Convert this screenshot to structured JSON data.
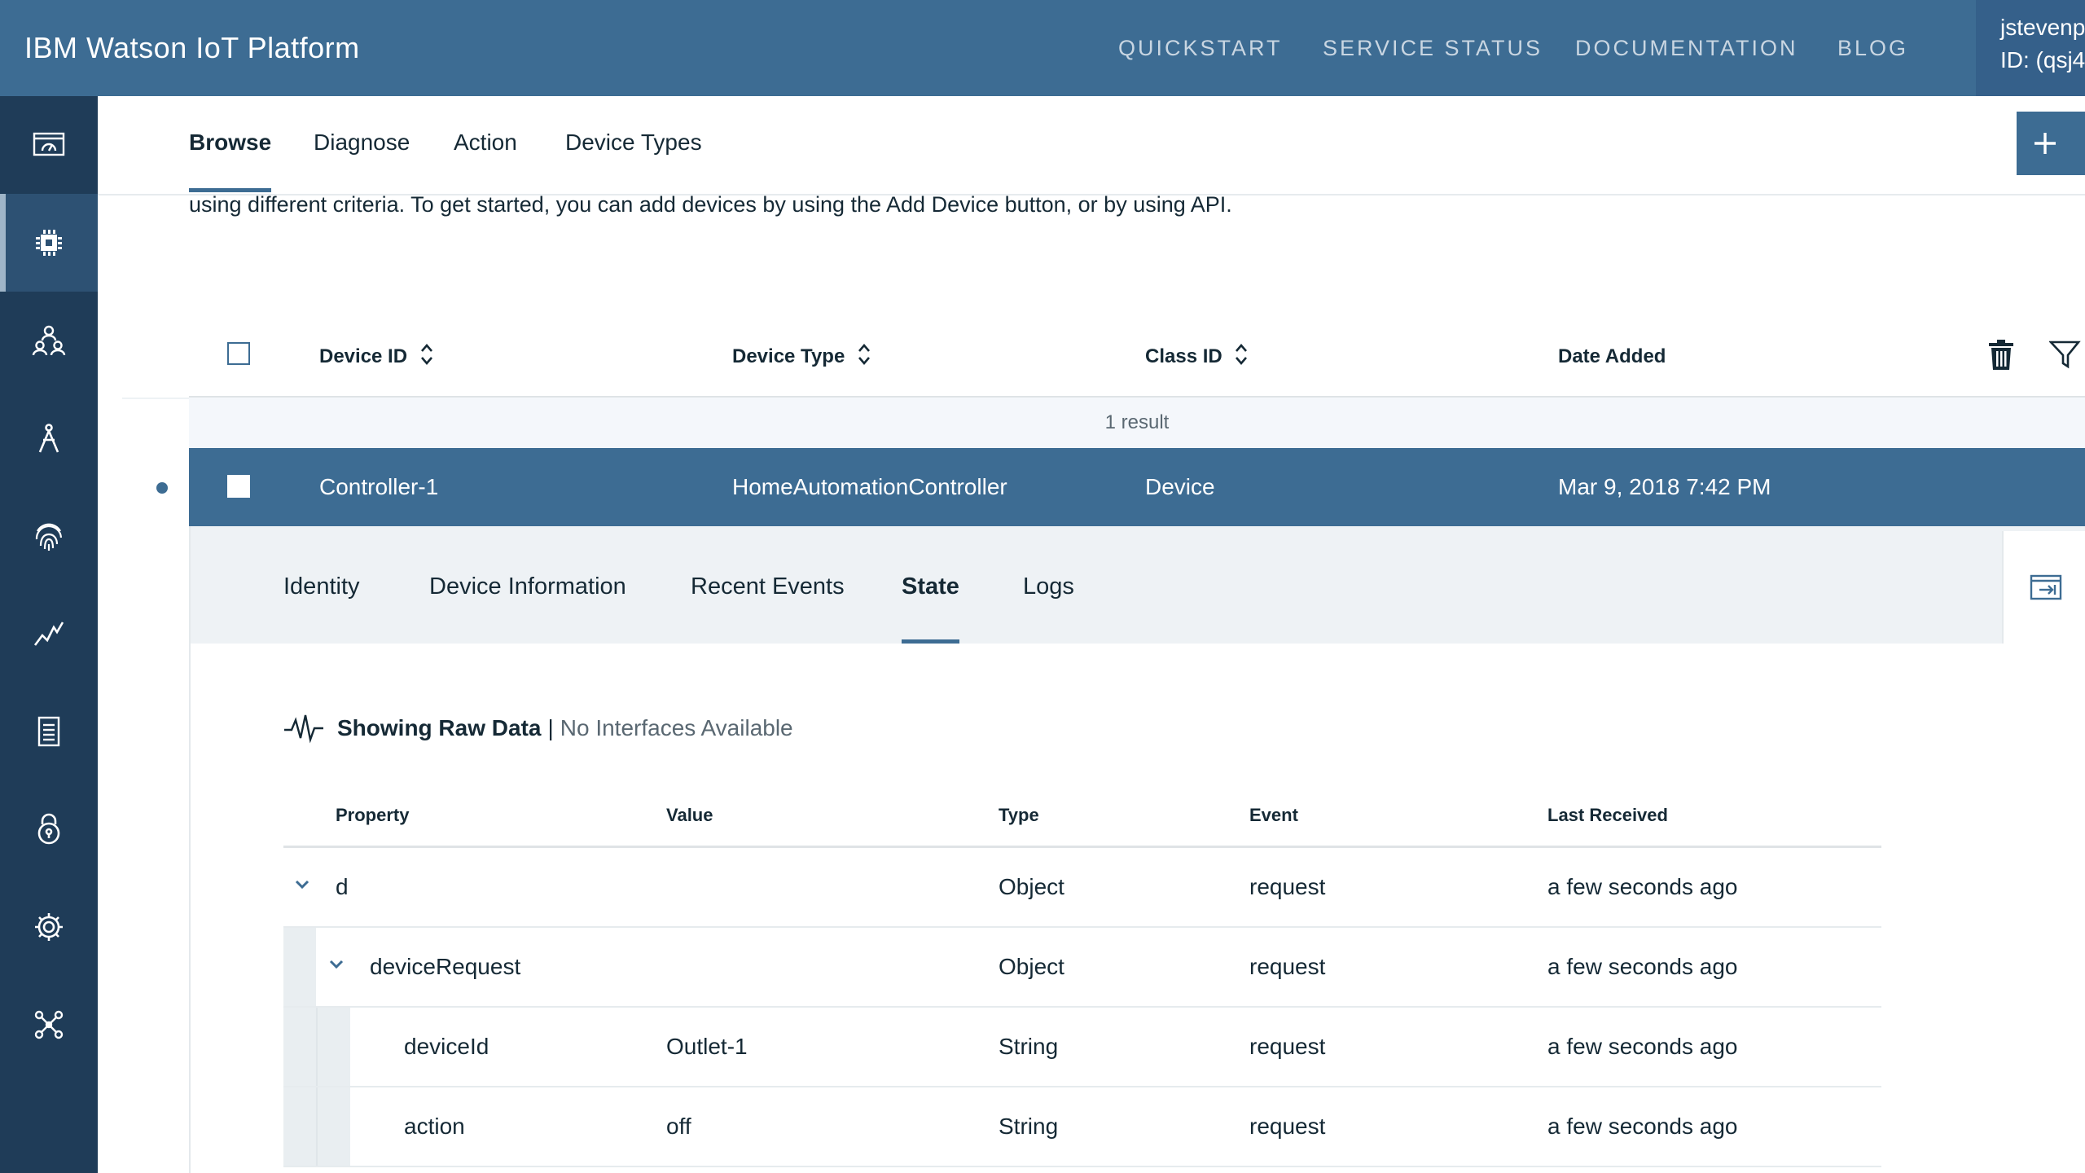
{
  "header": {
    "brand": "IBM Watson IoT Platform",
    "nav": [
      "QUICKSTART",
      "SERVICE STATUS",
      "DOCUMENTATION",
      "BLOG"
    ],
    "user_name": "jstevenp",
    "user_id": "ID: (qsj4"
  },
  "sidebar": {
    "items": [
      {
        "icon": "dashboard-icon"
      },
      {
        "icon": "chip-icon",
        "active": true
      },
      {
        "icon": "members-icon"
      },
      {
        "icon": "apps-icon"
      },
      {
        "icon": "fingerprint-icon"
      },
      {
        "icon": "analytics-icon"
      },
      {
        "icon": "document-icon"
      },
      {
        "icon": "security-icon"
      },
      {
        "icon": "settings-icon"
      },
      {
        "icon": "extensions-icon"
      }
    ]
  },
  "subnav": {
    "tabs": [
      "Browse",
      "Diagnose",
      "Action",
      "Device Types"
    ],
    "active_tab": "Browse",
    "add_label": "+"
  },
  "intro_text": "using different criteria. To get started, you can add devices by using the Add Device button, or by using API.",
  "device_table": {
    "columns": [
      "Device ID",
      "Device Type",
      "Class ID",
      "Date Added"
    ],
    "results_text": "1 result",
    "rows": [
      {
        "device_id": "Controller-1",
        "device_type": "HomeAutomationController",
        "class_id": "Device",
        "date_added": "Mar 9, 2018 7:42 PM"
      }
    ]
  },
  "detail": {
    "tabs": [
      "Identity",
      "Device Information",
      "Recent Events",
      "State",
      "Logs"
    ],
    "active_tab": "State",
    "raw_title": "Showing Raw Data",
    "raw_separator": "|",
    "raw_subtitle": "No Interfaces Available",
    "columns": [
      "Property",
      "Value",
      "Type",
      "Event",
      "Last Received"
    ],
    "rows": [
      {
        "property": "d",
        "value": "",
        "type": "Object",
        "event": "request",
        "last_received": "a few seconds ago",
        "level": 0,
        "expandable": true
      },
      {
        "property": "deviceRequest",
        "value": "",
        "type": "Object",
        "event": "request",
        "last_received": "a few seconds ago",
        "level": 1,
        "expandable": true
      },
      {
        "property": "deviceId",
        "value": "Outlet-1",
        "type": "String",
        "event": "request",
        "last_received": "a few seconds ago",
        "level": 2,
        "expandable": false
      },
      {
        "property": "action",
        "value": "off",
        "type": "String",
        "event": "request",
        "last_received": "a few seconds ago",
        "level": 2,
        "expandable": false
      }
    ]
  },
  "colors": {
    "header_bg": "#3d6c93",
    "sidebar_bg": "#1f3c58",
    "selected_row": "#3d6c93",
    "accent": "#3d6c93"
  }
}
